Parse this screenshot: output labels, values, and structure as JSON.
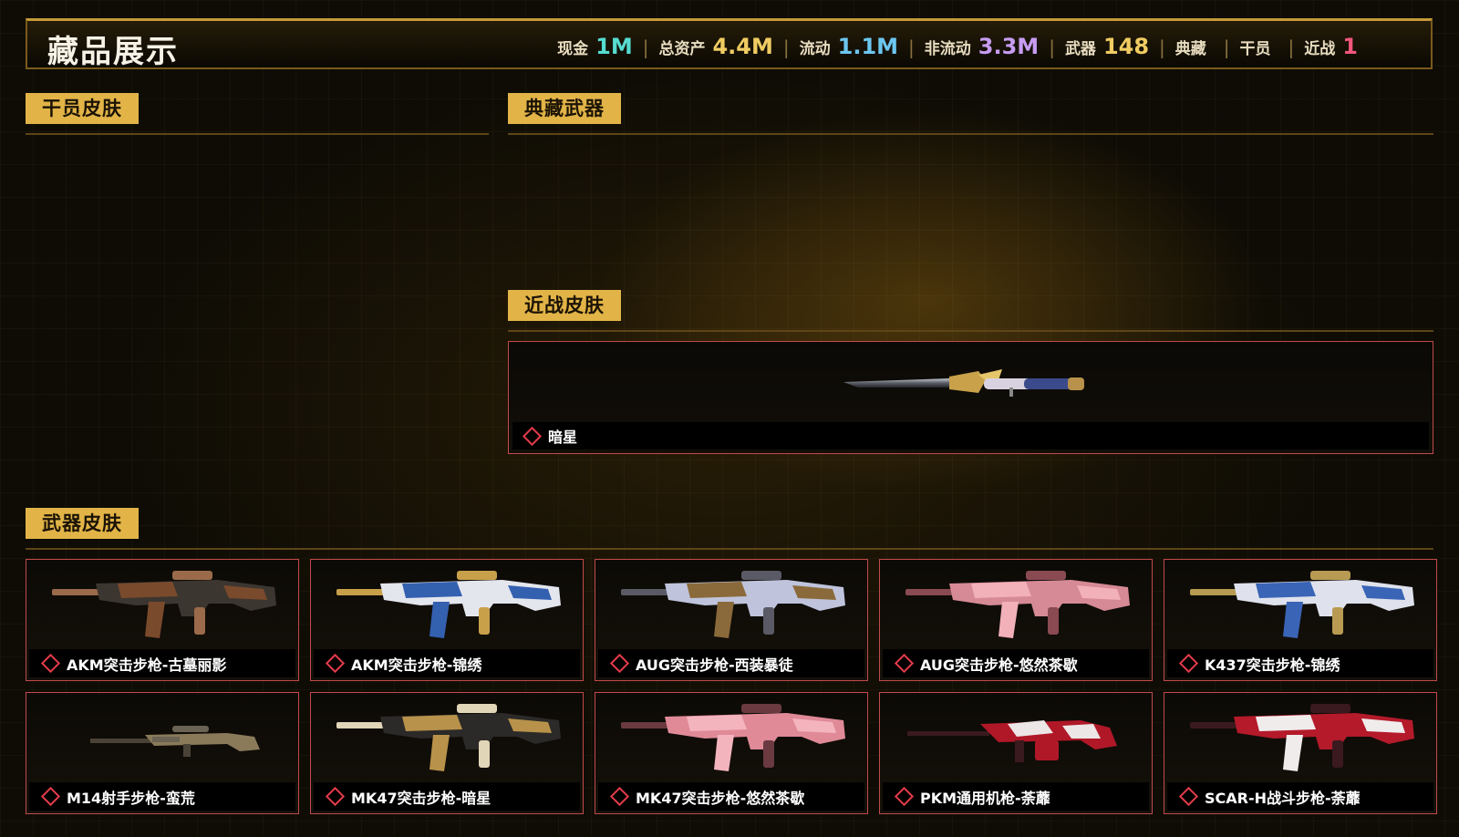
{
  "header": {
    "title": "藏品展示",
    "stats": [
      {
        "label": "现金",
        "value": "1M",
        "color": "#56dcd0"
      },
      {
        "label": "总资产",
        "value": "4.4M",
        "color": "#f0cc62"
      },
      {
        "label": "流动",
        "value": "1.1M",
        "color": "#6cc6ef"
      },
      {
        "label": "非流动",
        "value": "3.3M",
        "color": "#c79cf2"
      },
      {
        "label": "武器",
        "value": "148",
        "color": "#f0cc62"
      },
      {
        "label": "典藏",
        "value": "",
        "color": "#f0cc62"
      },
      {
        "label": "干员",
        "value": "",
        "color": "#f0cc62"
      },
      {
        "label": "近战",
        "value": "1",
        "color": "#f0577a"
      }
    ],
    "separator": "|"
  },
  "sections": {
    "operator_skins": "干员皮肤",
    "collection_weapons": "典藏武器",
    "melee_skins": "近战皮肤",
    "weapon_skins": "武器皮肤"
  },
  "melee": {
    "items": [
      {
        "name": "暗星",
        "icon": "knife-icon"
      }
    ]
  },
  "weapons": {
    "items": [
      {
        "name": "AKM突击步枪-古墓丽影",
        "icon": "rifle-icon",
        "palette": [
          "#3c3630",
          "#7a4a2c",
          "#9a6a4a"
        ]
      },
      {
        "name": "AKM突击步枪-锦绣",
        "icon": "rifle-icon",
        "palette": [
          "#e4e6ee",
          "#3460b0",
          "#c8a04a"
        ]
      },
      {
        "name": "AUG突击步枪-西装暴徒",
        "icon": "rifle-icon",
        "palette": [
          "#bfc4dc",
          "#8a6a3a",
          "#5a5a66"
        ]
      },
      {
        "name": "AUG突击步枪-悠然茶歇",
        "icon": "rifle-icon",
        "palette": [
          "#d68a96",
          "#f2b0b8",
          "#8a4a52"
        ]
      },
      {
        "name": "K437突击步枪-锦绣",
        "icon": "rifle-icon",
        "palette": [
          "#dfe2ec",
          "#3a64b6",
          "#b89a52"
        ]
      },
      {
        "name": "M14射手步枪-蛮荒",
        "icon": "sniper-rifle-icon",
        "palette": [
          "#6a6252",
          "#8a7a5a",
          "#4a4236"
        ]
      },
      {
        "name": "MK47突击步枪-暗星",
        "icon": "rifle-icon",
        "palette": [
          "#2c2a28",
          "#b8924a",
          "#e2d6b8"
        ]
      },
      {
        "name": "MK47突击步枪-悠然茶歇",
        "icon": "rifle-icon",
        "palette": [
          "#e08a98",
          "#f4b4be",
          "#6a3a40"
        ]
      },
      {
        "name": "PKM通用机枪-荼蘼",
        "icon": "machine-gun-icon",
        "palette": [
          "#b01828",
          "#ece6e6",
          "#3a1a1e"
        ]
      },
      {
        "name": "SCAR-H战斗步枪-荼蘼",
        "icon": "rifle-icon",
        "palette": [
          "#b41a2a",
          "#f0ecec",
          "#3a1a1e"
        ]
      }
    ]
  }
}
